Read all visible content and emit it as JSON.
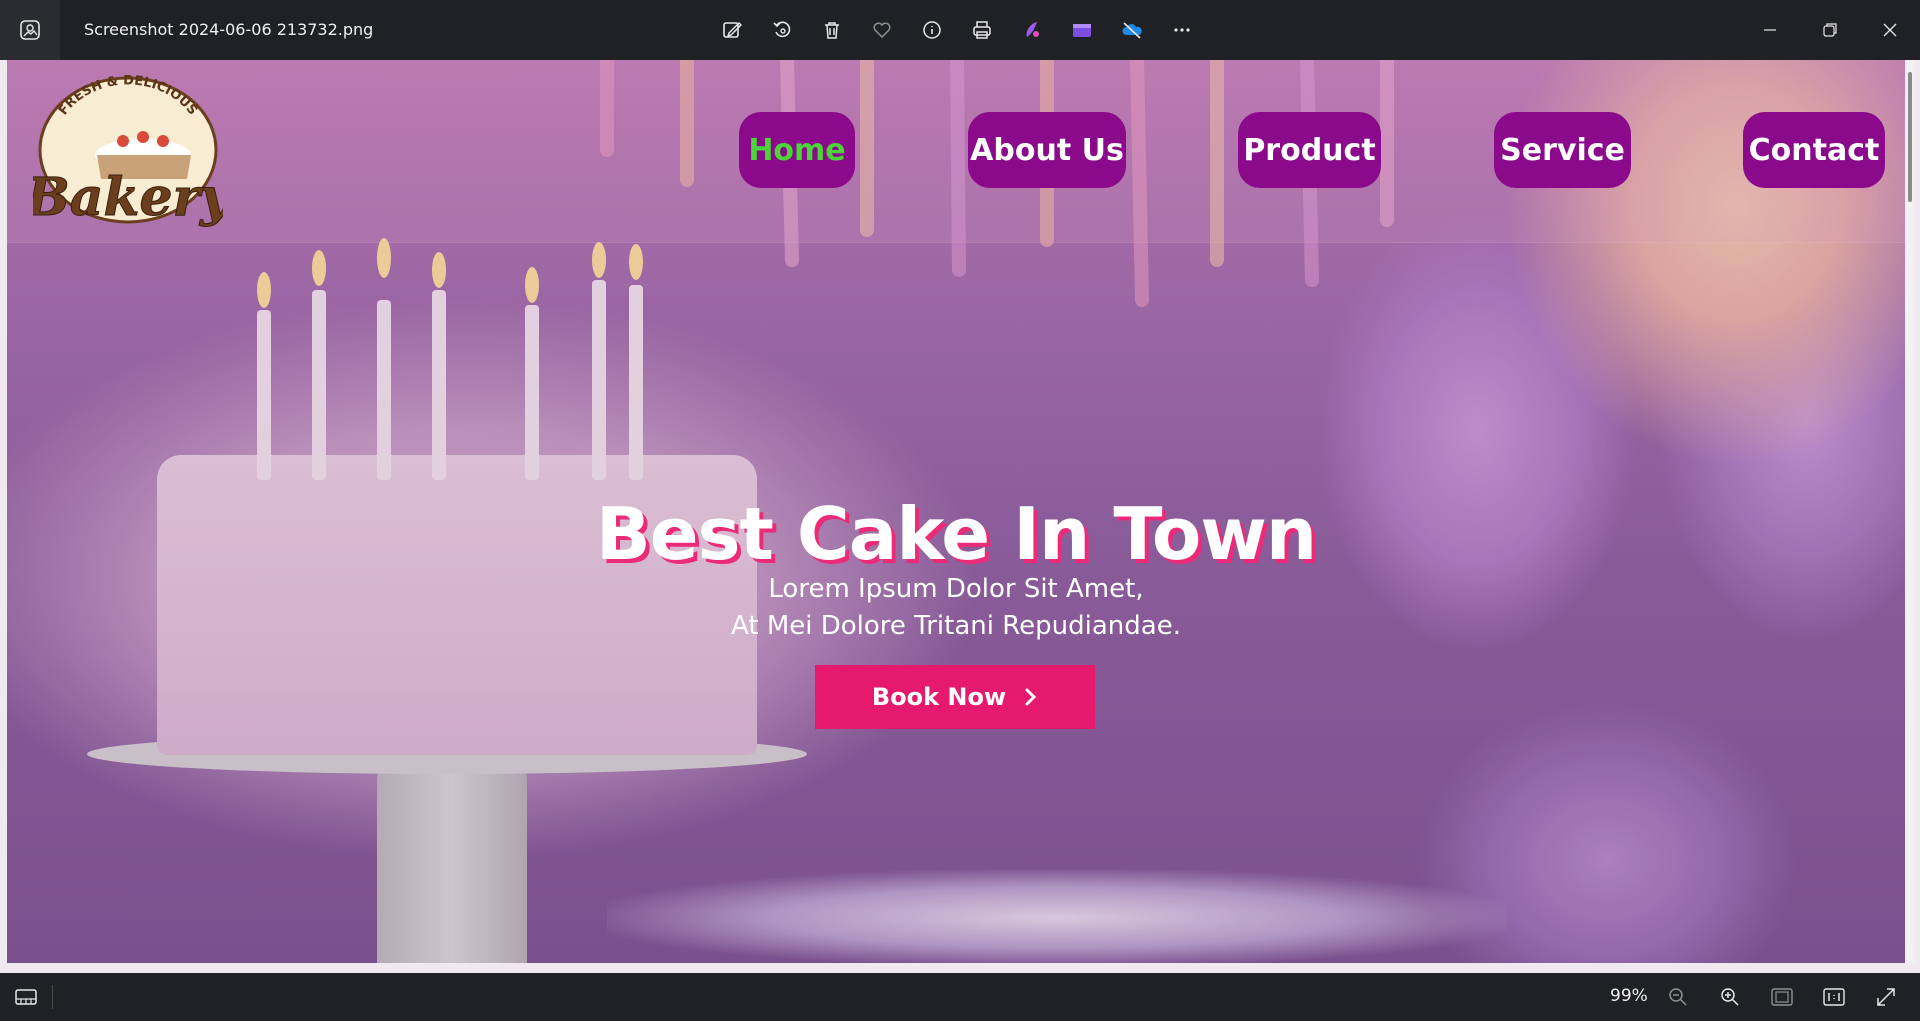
{
  "window": {
    "file_name": "Screenshot 2024-06-06 213732.png",
    "toolbar": [
      {
        "name": "edit-image-icon"
      },
      {
        "name": "rotate-icon"
      },
      {
        "name": "delete-icon"
      },
      {
        "name": "favorite-heart-icon"
      },
      {
        "name": "info-icon"
      },
      {
        "name": "print-icon"
      },
      {
        "name": "designer-icon"
      },
      {
        "name": "clipchamp-icon"
      },
      {
        "name": "onedrive-icon"
      },
      {
        "name": "more-icon"
      }
    ],
    "controls": [
      "minimize-icon",
      "restore-icon",
      "close-icon"
    ]
  },
  "site": {
    "logo": {
      "top_text": "FRESH & DELICIOUS",
      "brand": "Bakery"
    },
    "nav": [
      {
        "label": "Home",
        "active": true
      },
      {
        "label": "About Us",
        "active": false
      },
      {
        "label": "Product",
        "active": false
      },
      {
        "label": "Service",
        "active": false
      },
      {
        "label": "Contact",
        "active": false
      }
    ],
    "hero": {
      "title": "Best Cake In Town",
      "subtitle_line1": "Lorem Ipsum Dolor Sit Amet,",
      "subtitle_line2": "At Mei Dolore Tritani Repudiandae.",
      "cta_label": "Book Now",
      "cta_icon": "chevron-right-icon"
    },
    "colors": {
      "nav_bg": "#8b0a8b",
      "nav_active_text": "#4cd43a",
      "cta_bg": "#e5196e",
      "title_shadow": "#ec2b78"
    }
  },
  "statusbar": {
    "zoom": "99%"
  }
}
